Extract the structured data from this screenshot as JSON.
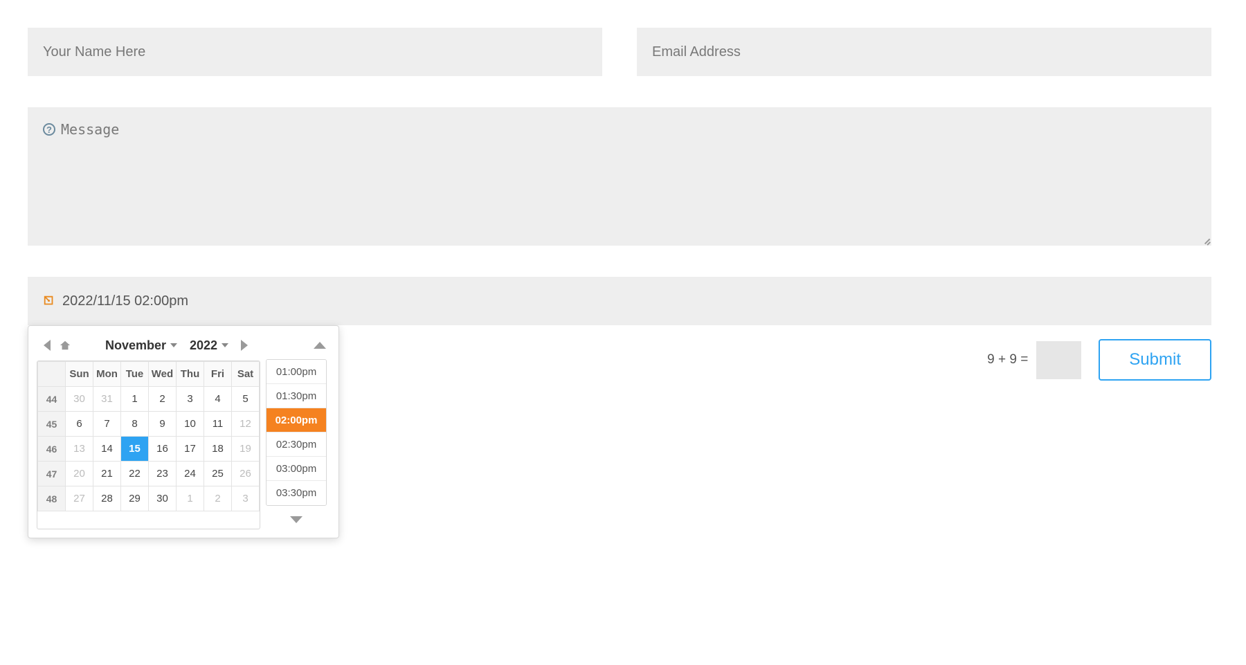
{
  "form": {
    "name_placeholder": "Your Name Here",
    "email_placeholder": "Email Address",
    "message_placeholder": "Message",
    "datetime_value": "2022/11/15 02:00pm",
    "captcha_question": "9 + 9 =",
    "submit_label": "Submit"
  },
  "calendar": {
    "month_label": "November",
    "year_label": "2022",
    "weekday_headers": [
      "Sun",
      "Mon",
      "Tue",
      "Wed",
      "Thu",
      "Fri",
      "Sat"
    ],
    "weeks": [
      {
        "wk": "44",
        "days": [
          {
            "n": "30",
            "other": true
          },
          {
            "n": "31",
            "other": true
          },
          {
            "n": "1"
          },
          {
            "n": "2"
          },
          {
            "n": "3"
          },
          {
            "n": "4"
          },
          {
            "n": "5"
          }
        ]
      },
      {
        "wk": "45",
        "days": [
          {
            "n": "6"
          },
          {
            "n": "7"
          },
          {
            "n": "8"
          },
          {
            "n": "9"
          },
          {
            "n": "10"
          },
          {
            "n": "11"
          },
          {
            "n": "12",
            "other": true
          }
        ]
      },
      {
        "wk": "46",
        "days": [
          {
            "n": "13",
            "other": true
          },
          {
            "n": "14"
          },
          {
            "n": "15",
            "selected": true
          },
          {
            "n": "16"
          },
          {
            "n": "17"
          },
          {
            "n": "18"
          },
          {
            "n": "19",
            "other": true
          }
        ]
      },
      {
        "wk": "47",
        "days": [
          {
            "n": "20",
            "other": true
          },
          {
            "n": "21"
          },
          {
            "n": "22"
          },
          {
            "n": "23"
          },
          {
            "n": "24"
          },
          {
            "n": "25"
          },
          {
            "n": "26",
            "other": true
          }
        ]
      },
      {
        "wk": "48",
        "days": [
          {
            "n": "27",
            "other": true
          },
          {
            "n": "28"
          },
          {
            "n": "29"
          },
          {
            "n": "30"
          },
          {
            "n": "1",
            "other": true
          },
          {
            "n": "2",
            "other": true
          },
          {
            "n": "3",
            "other": true
          }
        ]
      }
    ],
    "times": [
      {
        "t": "01:00pm"
      },
      {
        "t": "01:30pm"
      },
      {
        "t": "02:00pm",
        "selected": true
      },
      {
        "t": "02:30pm"
      },
      {
        "t": "03:00pm"
      },
      {
        "t": "03:30pm"
      }
    ]
  }
}
